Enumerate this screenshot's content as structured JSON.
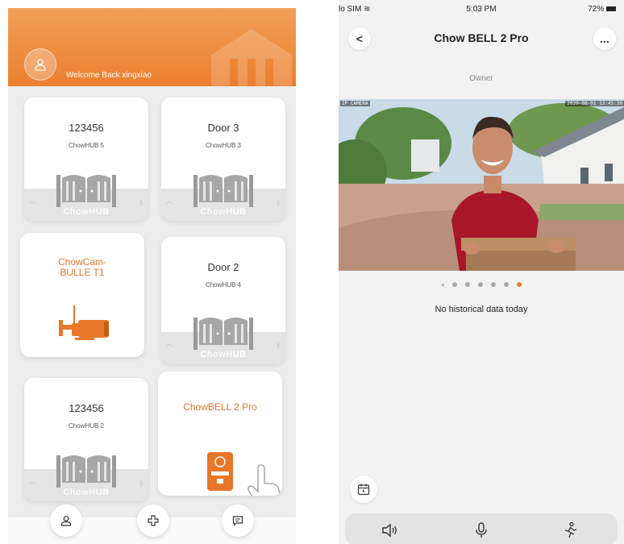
{
  "left": {
    "welcome": "Welcome Back xingxiao",
    "devices": [
      {
        "title": "123456",
        "subtitle": "ChowHUB 5",
        "type": "hub",
        "brand": "ChowHUB"
      },
      {
        "title": "Door 3",
        "subtitle": "ChowHUB 3",
        "type": "hub",
        "brand": "ChowHUB"
      },
      {
        "title": "ChowCam-BULLE T1",
        "subtitle": "",
        "type": "camera"
      },
      {
        "title": "Door 2",
        "subtitle": "ChowHUB 4",
        "type": "hub",
        "brand": "ChowHUB"
      },
      {
        "title": "123456",
        "subtitle": "ChowHUB 2",
        "type": "hub",
        "brand": "ChowHUB"
      },
      {
        "title": "ChowBELL 2 Pro",
        "subtitle": "",
        "type": "doorbell"
      }
    ],
    "nav": [
      {
        "name": "profile",
        "icon": "person-icon"
      },
      {
        "name": "add-device",
        "icon": "plus-icon"
      },
      {
        "name": "messages",
        "icon": "message-icon"
      }
    ]
  },
  "right": {
    "status": {
      "carrier": "lo SIM",
      "time": "5:03 PM",
      "battery": "72%"
    },
    "nav": {
      "back": "<",
      "title": "Chow BELL 2 Pro",
      "more": "..."
    },
    "owner": "Owner",
    "video": {
      "camera_label": "IP CAMERA",
      "timestamp": "2020-08-01 12:45:30"
    },
    "page_dots": {
      "count": 7,
      "active_index": 6
    },
    "empty_message": "No historical data today",
    "actions": [
      {
        "name": "speaker",
        "icon": "speaker-icon"
      },
      {
        "name": "microphone",
        "icon": "microphone-icon"
      },
      {
        "name": "motion",
        "icon": "running-person-icon"
      }
    ]
  },
  "colors": {
    "accent": "#eb7f2f",
    "header_light": "#f0a057",
    "background": "#ededed"
  }
}
